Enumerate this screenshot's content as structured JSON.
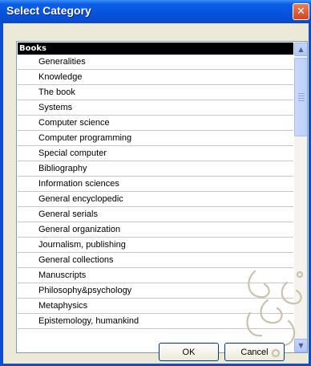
{
  "dialog": {
    "title": "Select Category",
    "close_glyph": "✕"
  },
  "list": {
    "header": "Books",
    "items": [
      "Generalities",
      "Knowledge",
      "The book",
      "Systems",
      "Computer science",
      "Computer programming",
      "Special computer",
      "Bibliography",
      "Information sciences",
      "General encyclopedic",
      "General serials",
      "General organization",
      "Journalism, publishing",
      "General collections",
      "Manuscripts",
      "Philosophy&psychology",
      "Metaphysics",
      "Epistemology, humankind"
    ]
  },
  "scrollbar": {
    "up_glyph": "▲",
    "down_glyph": "▼",
    "thumb_position": 0.0
  },
  "buttons": {
    "ok_label": "OK",
    "cancel_label": "Cancel"
  },
  "colors": {
    "titlebar": "#0754df",
    "selection": "#000000",
    "close_button": "#d4451f",
    "dialog_face": "#ece9d8"
  },
  "icons": {
    "close": "close-icon",
    "scroll_up": "arrow-up-icon",
    "scroll_down": "arrow-down-icon"
  }
}
